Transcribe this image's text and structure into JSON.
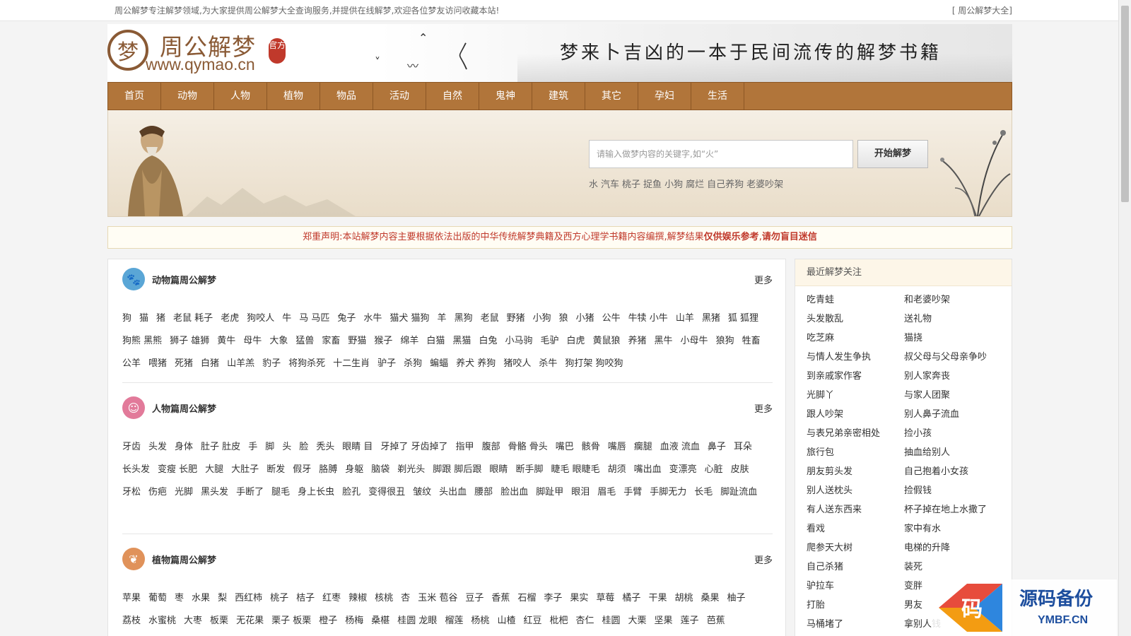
{
  "topbar": {
    "intro": "周公解梦专注解梦领域,为大家提供周公解梦大全查询服务,并提供在线解梦,欢迎各位梦友访问收藏本站!",
    "link": "[ 周公解梦大全]"
  },
  "header": {
    "logo_char": "梦",
    "logo_title": "周公解梦",
    "logo_url": "www.qymao.cn",
    "seal": "官方",
    "slogan": "梦来卜吉凶的一本于民间流传的解梦书籍"
  },
  "nav": [
    "首页",
    "动物",
    "人物",
    "植物",
    "物品",
    "活动",
    "自然",
    "鬼神",
    "建筑",
    "其它",
    "孕妇",
    "生活"
  ],
  "search": {
    "placeholder": "请输入做梦内容的关键字,如“火”",
    "button": "开始解梦",
    "hotwords": [
      "水",
      "汽车",
      "桃子",
      "捉鱼",
      "小狗",
      "腐烂",
      "自己养狗",
      "老婆吵架"
    ]
  },
  "notice": {
    "text": "郑重声明:本站解梦内容主要根据依法出版的中华传统解梦典籍及西方心理学书籍内容编撰,解梦结果",
    "bold1": "仅供娱乐参考",
    "sep": ",",
    "bold2": "请勿盲目迷信"
  },
  "sections": [
    {
      "title": "动物篇周公解梦",
      "more": "更多",
      "color": "#5aa6d6",
      "tags": [
        "狗",
        "猫",
        "猪",
        "老鼠 耗子",
        "老虎",
        "狗咬人",
        "牛",
        "马 马匹",
        "兔子",
        "水牛",
        "猫犬 猫狗",
        "羊",
        "黑狗",
        "老鼠",
        "野猪",
        "小狗",
        "狼",
        "小猪",
        "公牛",
        "牛犊 小牛",
        "山羊",
        "黑猪",
        "狐 狐狸",
        "狗熊 黑熊",
        "狮子 雄狮",
        "黄牛",
        "母牛",
        "大象",
        "猛兽",
        "家畜",
        "野猫",
        "猴子",
        "绵羊",
        "白猫",
        "黑猫",
        "白兔",
        "小马驹",
        "毛驴",
        "白虎",
        "黄鼠狼",
        "养猪",
        "黑牛",
        "小母牛",
        "狼狗",
        "牲畜",
        "公羊",
        "喂猪",
        "死猪",
        "白猪",
        "山羊羔",
        "豹子",
        "将狗杀死",
        "十二生肖",
        "驴子",
        "杀狗",
        "蝙蝠",
        "养犬 养狗",
        "猪咬人",
        "杀牛",
        "狗打架 狗咬狗"
      ]
    },
    {
      "title": "人物篇周公解梦",
      "more": "更多",
      "color": "#e27a9a",
      "tags": [
        "牙齿",
        "头发",
        "身体",
        "肚子 肚皮",
        "手",
        "脚",
        "头",
        "脸",
        "秃头",
        "眼睛 目",
        "牙掉了 牙齿掉了",
        "指甲",
        "腹部",
        "骨骼 骨头",
        "嘴巴",
        "骸骨",
        "嘴唇",
        "瘸腿",
        "血液 流血",
        "鼻子",
        "耳朵",
        "长头发",
        "变瘦 长肥",
        "大腿",
        "大肚子",
        "断发",
        "假牙",
        "胳膊",
        "身躯",
        "脑袋",
        "剃光头",
        "脚跟 脚后跟",
        "眼睛",
        "断手脚",
        "睫毛 眼睫毛",
        "胡须",
        "嘴出血",
        "变漂亮",
        "心脏",
        "皮肤",
        "牙松",
        "伤疤",
        "光脚",
        "黑头发",
        "手断了",
        "腿毛",
        "身上长虫",
        "脸孔",
        "变得很丑",
        "皱纹",
        "头出血",
        "腰部",
        "脸出血",
        "脚趾甲",
        "眼泪",
        "眉毛",
        "手臂",
        "手脚无力",
        "长毛",
        "脚趾流血"
      ]
    },
    {
      "title": "植物篇周公解梦",
      "more": "更多",
      "color": "#e0925a",
      "tags": [
        "苹果",
        "葡萄",
        "枣",
        "水果",
        "梨",
        "西红柿",
        "桃子",
        "桔子",
        "红枣",
        "辣椒",
        "核桃",
        "杏",
        "玉米 苞谷",
        "豆子",
        "香蕉",
        "石榴",
        "李子",
        "果实",
        "草莓",
        "橘子",
        "干果",
        "胡桃",
        "桑果",
        "柚子",
        "荔枝",
        "水蜜桃",
        "大枣",
        "板栗",
        "无花果",
        "栗子 板栗",
        "橙子",
        "杨梅",
        "桑椹",
        "桂圆 龙眼",
        "榴莲",
        "杨桃",
        "山楂",
        "红豆",
        "枇杷",
        "杏仁",
        "桂圆",
        "大栗",
        "坚果",
        "莲子",
        "芭蕉"
      ]
    }
  ],
  "sidebar": {
    "title": "最近解梦关注",
    "items": [
      "吃青蛙",
      "和老婆吵架",
      "头发散乱",
      "送礼物",
      "吃芝麻",
      "猫挠",
      "与情人发生争执",
      "叔父母与父母亲争吵",
      "到亲戚家作客",
      "别人家奔丧",
      "光脚丫",
      "与家人团聚",
      "跟人吵架",
      "别人鼻子流血",
      "与表兄弟亲密相处",
      "捡小孩",
      "旅行包",
      "抽血给别人",
      "朋友剪头发",
      "自己抱着小女孩",
      "别人送枕头",
      "捡假钱",
      "有人送东西来",
      "杯子掉在地上水撒了",
      "看戏",
      "家中有水",
      "爬参天大树",
      "电梯的升降",
      "自己杀猪",
      "装死",
      "驴拉车",
      "变胖",
      "打胎",
      "男友",
      "马桶堵了",
      "拿别人钱"
    ]
  },
  "watermark": {
    "char": "码",
    "title": "源码备份",
    "domain": "YMBF.CN"
  }
}
